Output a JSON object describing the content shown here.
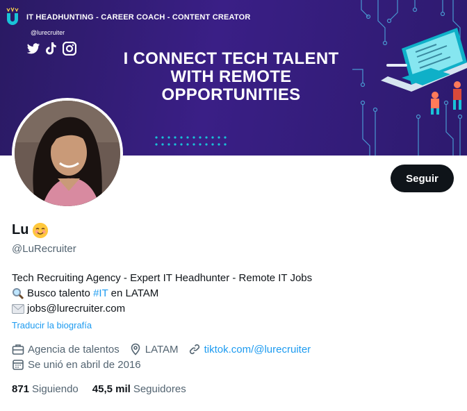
{
  "banner": {
    "top_line": "IT HEADHUNTING - CAREER COACH - CONTENT CREATOR",
    "handle": "@lurecruiter",
    "socials": [
      "twitter-icon",
      "tiktok-icon",
      "instagram-icon"
    ],
    "headline_lines": [
      "I CONNECT TECH TALENT",
      "WITH REMOTE",
      "OPPORTUNITIES"
    ],
    "colors": {
      "background": "#2d1a6e",
      "accent": "#00d8f0"
    }
  },
  "profile": {
    "follow_label": "Seguir",
    "name": "Lu",
    "handle": "@LuRecruiter",
    "bio_line1": "Tech Recruiting Agency - Expert IT Headhunter - Remote IT Jobs",
    "bio_line2_prefix": "Busco talento ",
    "bio_hashtag": "#IT",
    "bio_line2_suffix": " en LATAM",
    "bio_line3": "jobs@lurecruiter.com",
    "translate_label": "Traducir la biografía",
    "category": "Agencia de talentos",
    "location": "LATAM",
    "website": "tiktok.com/@lurecruiter",
    "joined": "Se unió en abril de 2016"
  },
  "stats": {
    "following_count": "871",
    "following_label": "Siguiendo",
    "followers_count": "45,5 mil",
    "followers_label": "Seguidores"
  },
  "colors": {
    "accent": "#1d9bf0",
    "text": "#0f1419",
    "muted": "#536471",
    "button": "#0f1419"
  }
}
